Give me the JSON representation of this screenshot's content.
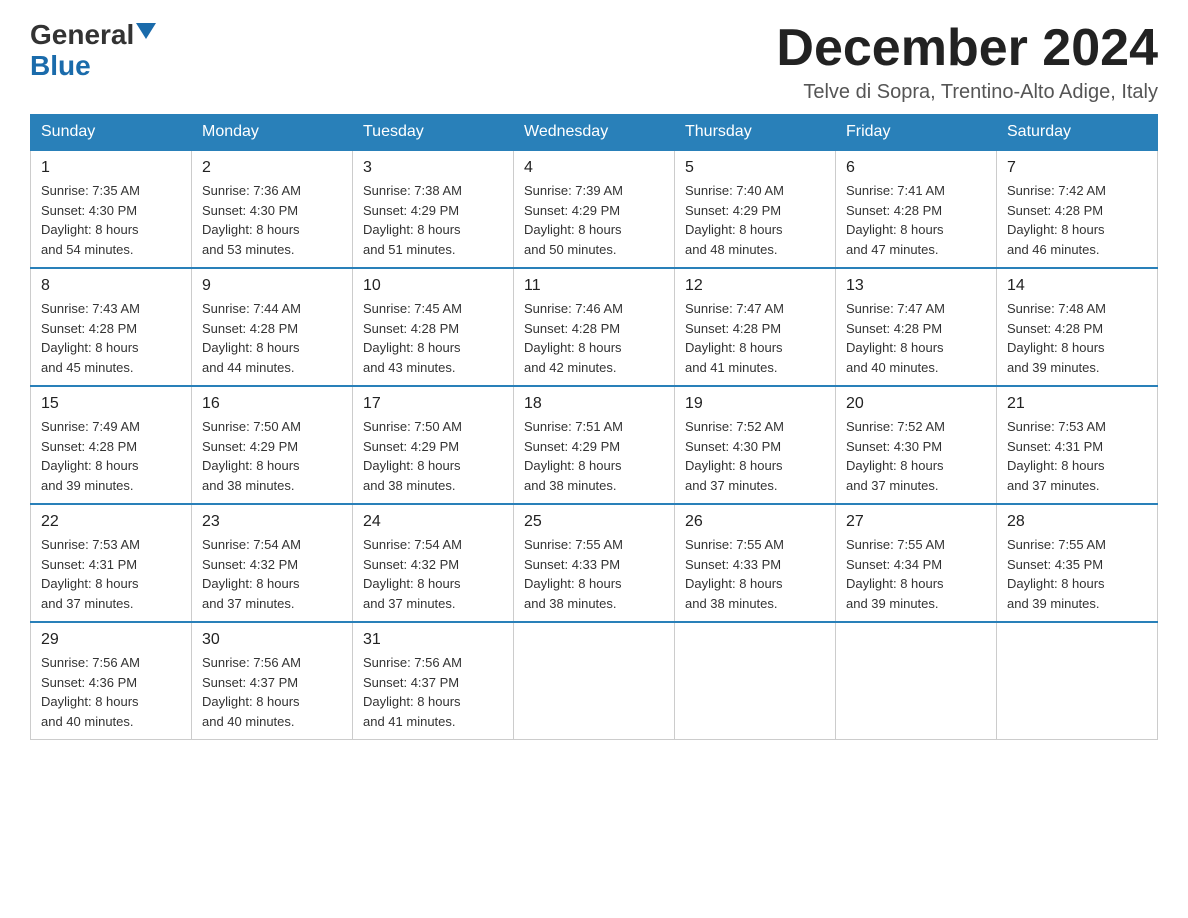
{
  "logo": {
    "general": "General",
    "blue": "Blue"
  },
  "header": {
    "month": "December 2024",
    "location": "Telve di Sopra, Trentino-Alto Adige, Italy"
  },
  "weekdays": [
    "Sunday",
    "Monday",
    "Tuesday",
    "Wednesday",
    "Thursday",
    "Friday",
    "Saturday"
  ],
  "weeks": [
    [
      {
        "day": "1",
        "sunrise": "7:35 AM",
        "sunset": "4:30 PM",
        "daylight": "8 hours and 54 minutes."
      },
      {
        "day": "2",
        "sunrise": "7:36 AM",
        "sunset": "4:30 PM",
        "daylight": "8 hours and 53 minutes."
      },
      {
        "day": "3",
        "sunrise": "7:38 AM",
        "sunset": "4:29 PM",
        "daylight": "8 hours and 51 minutes."
      },
      {
        "day": "4",
        "sunrise": "7:39 AM",
        "sunset": "4:29 PM",
        "daylight": "8 hours and 50 minutes."
      },
      {
        "day": "5",
        "sunrise": "7:40 AM",
        "sunset": "4:29 PM",
        "daylight": "8 hours and 48 minutes."
      },
      {
        "day": "6",
        "sunrise": "7:41 AM",
        "sunset": "4:28 PM",
        "daylight": "8 hours and 47 minutes."
      },
      {
        "day": "7",
        "sunrise": "7:42 AM",
        "sunset": "4:28 PM",
        "daylight": "8 hours and 46 minutes."
      }
    ],
    [
      {
        "day": "8",
        "sunrise": "7:43 AM",
        "sunset": "4:28 PM",
        "daylight": "8 hours and 45 minutes."
      },
      {
        "day": "9",
        "sunrise": "7:44 AM",
        "sunset": "4:28 PM",
        "daylight": "8 hours and 44 minutes."
      },
      {
        "day": "10",
        "sunrise": "7:45 AM",
        "sunset": "4:28 PM",
        "daylight": "8 hours and 43 minutes."
      },
      {
        "day": "11",
        "sunrise": "7:46 AM",
        "sunset": "4:28 PM",
        "daylight": "8 hours and 42 minutes."
      },
      {
        "day": "12",
        "sunrise": "7:47 AM",
        "sunset": "4:28 PM",
        "daylight": "8 hours and 41 minutes."
      },
      {
        "day": "13",
        "sunrise": "7:47 AM",
        "sunset": "4:28 PM",
        "daylight": "8 hours and 40 minutes."
      },
      {
        "day": "14",
        "sunrise": "7:48 AM",
        "sunset": "4:28 PM",
        "daylight": "8 hours and 39 minutes."
      }
    ],
    [
      {
        "day": "15",
        "sunrise": "7:49 AM",
        "sunset": "4:28 PM",
        "daylight": "8 hours and 39 minutes."
      },
      {
        "day": "16",
        "sunrise": "7:50 AM",
        "sunset": "4:29 PM",
        "daylight": "8 hours and 38 minutes."
      },
      {
        "day": "17",
        "sunrise": "7:50 AM",
        "sunset": "4:29 PM",
        "daylight": "8 hours and 38 minutes."
      },
      {
        "day": "18",
        "sunrise": "7:51 AM",
        "sunset": "4:29 PM",
        "daylight": "8 hours and 38 minutes."
      },
      {
        "day": "19",
        "sunrise": "7:52 AM",
        "sunset": "4:30 PM",
        "daylight": "8 hours and 37 minutes."
      },
      {
        "day": "20",
        "sunrise": "7:52 AM",
        "sunset": "4:30 PM",
        "daylight": "8 hours and 37 minutes."
      },
      {
        "day": "21",
        "sunrise": "7:53 AM",
        "sunset": "4:31 PM",
        "daylight": "8 hours and 37 minutes."
      }
    ],
    [
      {
        "day": "22",
        "sunrise": "7:53 AM",
        "sunset": "4:31 PM",
        "daylight": "8 hours and 37 minutes."
      },
      {
        "day": "23",
        "sunrise": "7:54 AM",
        "sunset": "4:32 PM",
        "daylight": "8 hours and 37 minutes."
      },
      {
        "day": "24",
        "sunrise": "7:54 AM",
        "sunset": "4:32 PM",
        "daylight": "8 hours and 37 minutes."
      },
      {
        "day": "25",
        "sunrise": "7:55 AM",
        "sunset": "4:33 PM",
        "daylight": "8 hours and 38 minutes."
      },
      {
        "day": "26",
        "sunrise": "7:55 AM",
        "sunset": "4:33 PM",
        "daylight": "8 hours and 38 minutes."
      },
      {
        "day": "27",
        "sunrise": "7:55 AM",
        "sunset": "4:34 PM",
        "daylight": "8 hours and 39 minutes."
      },
      {
        "day": "28",
        "sunrise": "7:55 AM",
        "sunset": "4:35 PM",
        "daylight": "8 hours and 39 minutes."
      }
    ],
    [
      {
        "day": "29",
        "sunrise": "7:56 AM",
        "sunset": "4:36 PM",
        "daylight": "8 hours and 40 minutes."
      },
      {
        "day": "30",
        "sunrise": "7:56 AM",
        "sunset": "4:37 PM",
        "daylight": "8 hours and 40 minutes."
      },
      {
        "day": "31",
        "sunrise": "7:56 AM",
        "sunset": "4:37 PM",
        "daylight": "8 hours and 41 minutes."
      },
      null,
      null,
      null,
      null
    ]
  ],
  "labels": {
    "sunrise": "Sunrise:",
    "sunset": "Sunset:",
    "daylight": "Daylight:"
  }
}
